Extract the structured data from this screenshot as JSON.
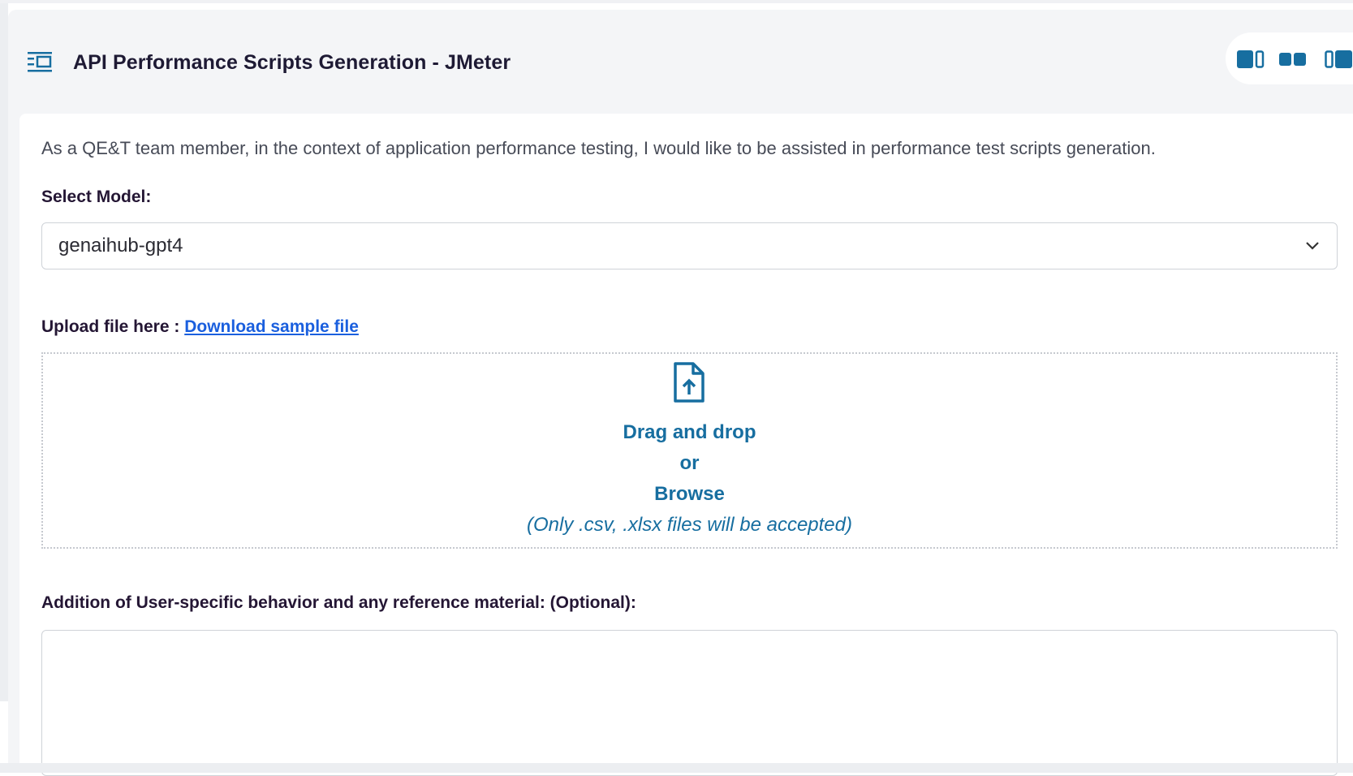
{
  "header": {
    "title": "API Performance Scripts Generation - JMeter",
    "icon": "list-panel-icon",
    "layout_buttons": [
      "layout-left-wide-icon",
      "layout-split-icon",
      "layout-right-wide-icon"
    ]
  },
  "main": {
    "description": "As a QE&T team member, in the context of application performance testing, I would like to be assisted in performance test scripts generation.",
    "model": {
      "label": "Select Model:",
      "selected": "genaihub-gpt4"
    },
    "upload": {
      "label": "Upload file here : ",
      "link": "Download sample file",
      "drag": "Drag and drop",
      "or": "or",
      "browse": "Browse",
      "note": "(Only .csv, .xlsx files will be accepted)"
    },
    "behavior": {
      "label": "Addition of User-specific behavior and any reference material: (Optional):",
      "value": ""
    }
  },
  "colors": {
    "accent": "#176ea0",
    "link": "#1a5fde",
    "title": "#1e1a34",
    "background": "#f4f5f7"
  }
}
